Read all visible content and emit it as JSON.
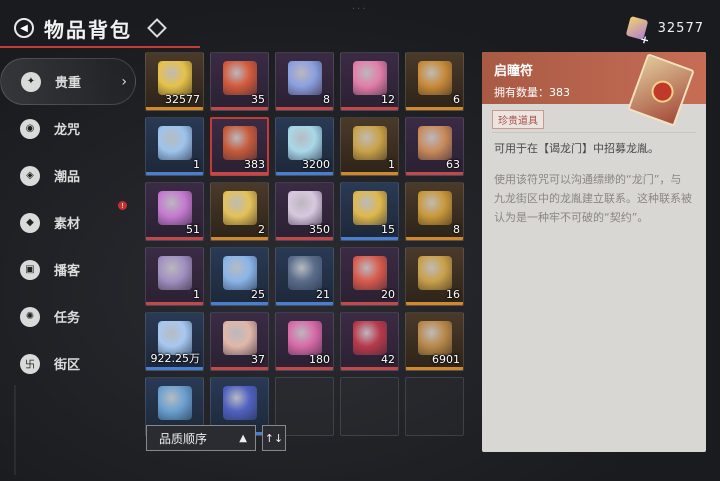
{
  "header": {
    "title": "物品背包"
  },
  "currency": {
    "value": "32577"
  },
  "sidebar": {
    "items": [
      {
        "label": "贵重",
        "icon": "gem-icon",
        "active": true
      },
      {
        "label": "龙咒",
        "icon": "rune-icon"
      },
      {
        "label": "潮品",
        "icon": "fashion-icon"
      },
      {
        "label": "素材",
        "icon": "material-icon",
        "badge": "!"
      },
      {
        "label": "播客",
        "icon": "podcast-icon"
      },
      {
        "label": "任务",
        "icon": "film-reel-icon"
      },
      {
        "label": "街区",
        "icon": "district-icon"
      }
    ]
  },
  "inventory": {
    "items": [
      {
        "count": "32577",
        "tone": "gold",
        "art": "#e6c24a"
      },
      {
        "count": "35",
        "tone": "purple",
        "art": "#d35a3a"
      },
      {
        "count": "8",
        "tone": "purple",
        "art": "#8aa0e0"
      },
      {
        "count": "12",
        "tone": "purple",
        "art": "#e27ea8"
      },
      {
        "count": "6",
        "tone": "gold",
        "art": "#c88a3a"
      },
      {
        "count": "1",
        "tone": "blue",
        "art": "#9ec4ec"
      },
      {
        "count": "383",
        "tone": "purple",
        "art": "#c65a3a",
        "selected": true
      },
      {
        "count": "3200",
        "tone": "blue",
        "art": "#a8d8e8"
      },
      {
        "count": "1",
        "tone": "gold",
        "art": "#c9a24a"
      },
      {
        "count": "63",
        "tone": "purple",
        "art": "#c88a5a"
      },
      {
        "count": "51",
        "tone": "purple",
        "art": "#c47ad0"
      },
      {
        "count": "2",
        "tone": "gold",
        "art": "#e3c25a"
      },
      {
        "count": "350",
        "tone": "purple",
        "art": "#d8c8e0"
      },
      {
        "count": "15",
        "tone": "blue",
        "art": "#e0b84a"
      },
      {
        "count": "8",
        "tone": "gold",
        "art": "#c9983a"
      },
      {
        "count": "1",
        "tone": "purple",
        "art": "#a090c0"
      },
      {
        "count": "25",
        "tone": "blue",
        "art": "#8ab4e8"
      },
      {
        "count": "21",
        "tone": "blue",
        "art": "#5a6c8a"
      },
      {
        "count": "20",
        "tone": "purple",
        "art": "#d85a4a"
      },
      {
        "count": "16",
        "tone": "gold",
        "art": "#c9a04a"
      },
      {
        "count": "922.25万",
        "tone": "blue",
        "art": "#a8c8f0"
      },
      {
        "count": "37",
        "tone": "purple",
        "art": "#e0b8a8"
      },
      {
        "count": "180",
        "tone": "purple",
        "art": "#d86aa8"
      },
      {
        "count": "42",
        "tone": "purple",
        "art": "#b83a4a"
      },
      {
        "count": "6901",
        "tone": "gold",
        "art": "#b8884a"
      },
      {
        "count": "",
        "tone": "blue",
        "art": "#6aa0d0"
      },
      {
        "count": "",
        "tone": "blue",
        "art": "#5060c0"
      }
    ]
  },
  "sort": {
    "label": "品质顺序",
    "toggle_icon": "sort-order-icon"
  },
  "detail": {
    "name": "启瞳符",
    "owned": "拥有数量：383",
    "tag": "珍贵道具",
    "description": "可用于在【谒龙门】中招募龙胤。",
    "lore": "使用该符咒可以沟通缥缈的“龙门”，与九龙街区中的龙胤建立联系。这种联系被认为是一种牢不可破的“契约”。"
  }
}
